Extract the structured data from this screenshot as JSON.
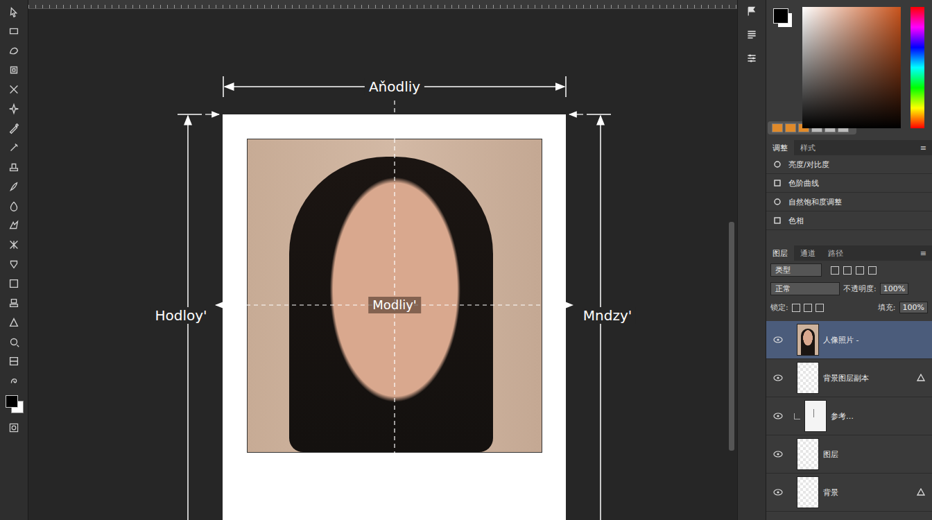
{
  "canvas": {
    "dimensions": {
      "top": "Aňodliy",
      "left": "Hodloy'",
      "right": "Mndzy'",
      "center": "Modliy'"
    }
  },
  "adjustments": {
    "tabs": [
      {
        "label": "调整",
        "selected": true
      },
      {
        "label": "样式",
        "selected": false
      }
    ],
    "items": [
      "亮度/对比度",
      "色阶曲线",
      "自然饱和度调整",
      "色相"
    ]
  },
  "layers": {
    "tabs": [
      {
        "label": "图层",
        "selected": true
      },
      {
        "label": "通道",
        "selected": false
      },
      {
        "label": "路径",
        "selected": false
      }
    ],
    "kind_filter": "类型",
    "blend_mode": "正常",
    "opacity_label": "不透明度:",
    "opacity": "100%",
    "lock_label": "锁定:",
    "fill_label": "填充:",
    "fill": "100%",
    "items": [
      {
        "name": "人像照片 -",
        "selected": true,
        "visible": true,
        "kind": "photo",
        "effects": false,
        "indented": false
      },
      {
        "name": "背景图层副本",
        "selected": false,
        "visible": true,
        "kind": "blank",
        "effects": true,
        "indented": false
      },
      {
        "name": "参考…",
        "selected": false,
        "visible": true,
        "kind": "sketch",
        "effects": false,
        "indented": true
      },
      {
        "name": "图层",
        "selected": false,
        "visible": true,
        "kind": "blank",
        "effects": false,
        "indented": false
      },
      {
        "name": "背景",
        "selected": false,
        "visible": true,
        "kind": "blank",
        "effects": true,
        "indented": false
      }
    ]
  }
}
